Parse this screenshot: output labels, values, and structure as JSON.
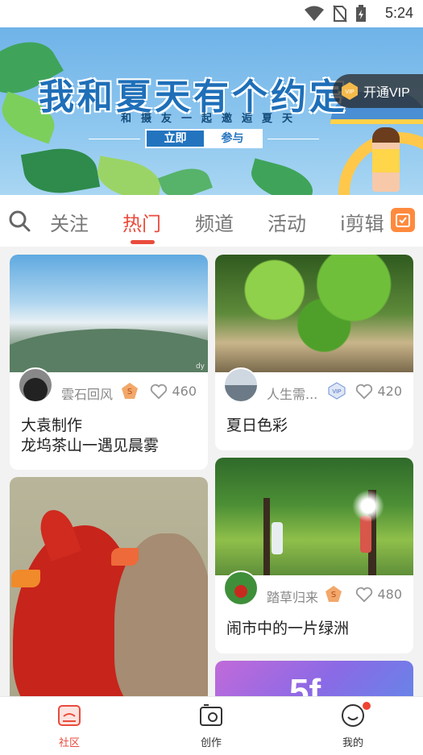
{
  "status_bar": {
    "time": "5:24"
  },
  "banner": {
    "title": "我和夏天有个约定",
    "subtitle": "和摄友一起邀逅夏天",
    "cta_left": "立即",
    "cta_right": "参与",
    "vip_label": "开通VIP",
    "vip_icon_text": "VIP"
  },
  "tabs": {
    "items": [
      {
        "label": "关注"
      },
      {
        "label": "热门"
      },
      {
        "label": "频道"
      },
      {
        "label": "活动"
      },
      {
        "label": "i剪辑"
      }
    ],
    "active_index": 1
  },
  "feed": {
    "cards": [
      {
        "author": "雲石回风",
        "likes": "460",
        "title_line1": "大袁制作",
        "title_line2": "龙坞茶山一遇见晨雾",
        "watermark": "dy"
      },
      {
        "author": "人生需...",
        "likes": "420",
        "title_line1": "夏日色彩",
        "vip_badge": "VIP"
      },
      {
        "author": "踏草归来",
        "likes": "480",
        "title_line1": "闹市中的一片绿洲"
      },
      {
        "author": "",
        "likes": "",
        "title_line1": ""
      },
      {
        "partial_text": "5f"
      }
    ]
  },
  "bottom_nav": {
    "items": [
      {
        "label": "社区"
      },
      {
        "label": "创作"
      },
      {
        "label": "我的"
      }
    ],
    "active_index": 0
  },
  "colors": {
    "accent": "#e94b3c",
    "vip_orange": "#ff8a3d",
    "banner_blue": "#6fb3e8"
  }
}
